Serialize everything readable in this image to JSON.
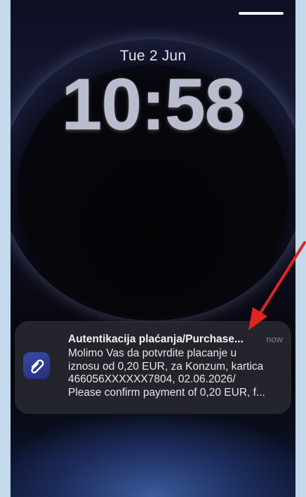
{
  "lock_screen": {
    "date": "Tue 2 Jun",
    "time": "10:58"
  },
  "notification": {
    "app_icon": "paperclip-icon",
    "title": "Autentikacija plaćanja/Purchase...",
    "time": "now",
    "body_lines": [
      "Molimo Vas da potvrdite placanje u",
      "iznosu od 0,20 EUR, za Konzum, kartica",
      "466056XXXXXX7804, 02.06.2026/",
      "Please confirm payment of 0,20 EUR, f..."
    ]
  },
  "annotation": {
    "arrow_icon": "red-arrow-icon",
    "color": "#e02424"
  },
  "colors": {
    "frame_background": "#c4d9ec",
    "notification_background": "#26272e",
    "app_icon_background": "#2e3a93"
  }
}
